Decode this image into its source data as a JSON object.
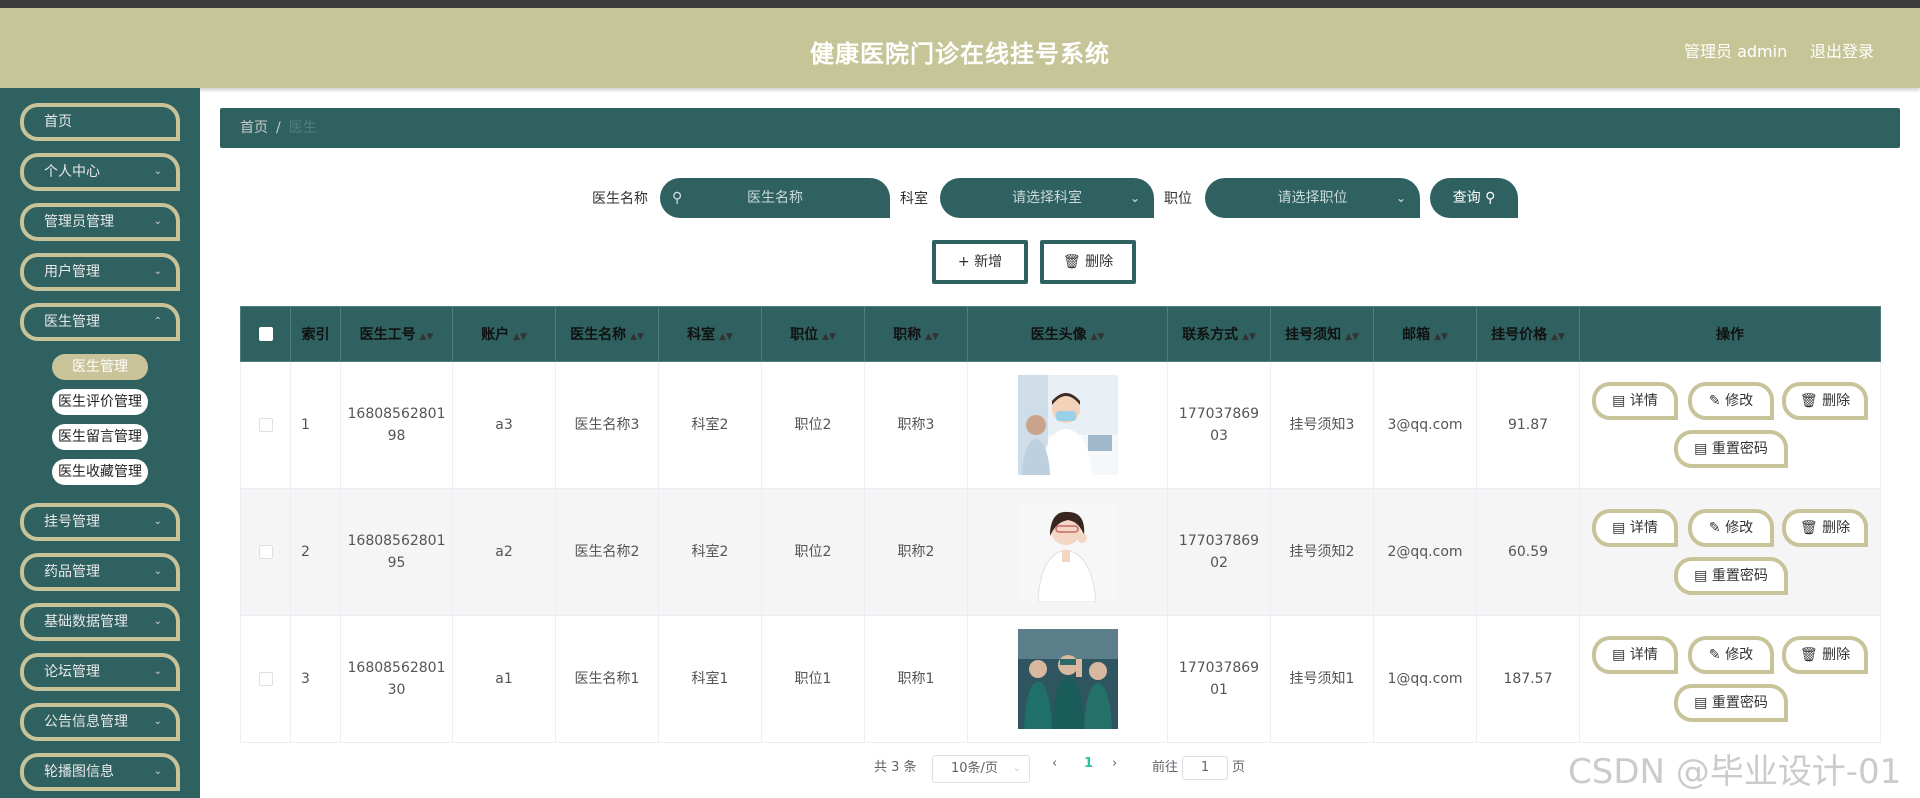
{
  "header": {
    "title": "健康医院门诊在线挂号系统",
    "admin_label": "管理员 admin",
    "logout_label": "退出登录"
  },
  "sidebar": {
    "items": [
      {
        "label": "首页"
      },
      {
        "label": "个人中心"
      },
      {
        "label": "管理员管理"
      },
      {
        "label": "用户管理"
      },
      {
        "label": "医生管理"
      },
      {
        "label": "挂号管理"
      },
      {
        "label": "药品管理"
      },
      {
        "label": "基础数据管理"
      },
      {
        "label": "论坛管理"
      },
      {
        "label": "公告信息管理"
      },
      {
        "label": "轮播图信息"
      }
    ],
    "sub_items": [
      {
        "label": "医生管理"
      },
      {
        "label": "医生评价管理"
      },
      {
        "label": "医生留言管理"
      },
      {
        "label": "医生收藏管理"
      }
    ]
  },
  "breadcrumb": {
    "home": "首页",
    "sep": "/",
    "current": "医生"
  },
  "filters": {
    "name_label": "医生名称",
    "name_placeholder": "医生名称",
    "dept_label": "科室",
    "dept_placeholder": "请选择科室",
    "position_label": "职位",
    "position_placeholder": "请选择职位",
    "query_label": "查询"
  },
  "actions": {
    "add_label": "新增",
    "delete_label": "删除"
  },
  "table": {
    "headers": [
      "索引",
      "医生工号",
      "账户",
      "医生名称",
      "科室",
      "职位",
      "职称",
      "医生头像",
      "联系方式",
      "挂号须知",
      "邮箱",
      "挂号价格",
      "操作"
    ],
    "rows": [
      {
        "index": "1",
        "code_a": "16808562801",
        "code_b": "98",
        "account": "a3",
        "name": "医生名称3",
        "dept": "科室2",
        "position": "职位2",
        "title": "职称3",
        "phone_a": "177037869",
        "phone_b": "03",
        "notice": "挂号须知3",
        "email": "3@qq.com",
        "price": "91.87"
      },
      {
        "index": "2",
        "code_a": "16808562801",
        "code_b": "95",
        "account": "a2",
        "name": "医生名称2",
        "dept": "科室2",
        "position": "职位2",
        "title": "职称2",
        "phone_a": "177037869",
        "phone_b": "02",
        "notice": "挂号须知2",
        "email": "2@qq.com",
        "price": "60.59"
      },
      {
        "index": "3",
        "code_a": "16808562801",
        "code_b": "30",
        "account": "a1",
        "name": "医生名称1",
        "dept": "科室1",
        "position": "职位1",
        "title": "职称1",
        "phone_a": "177037869",
        "phone_b": "01",
        "notice": "挂号须知1",
        "email": "1@qq.com",
        "price": "187.57"
      }
    ],
    "row_ops": {
      "detail": "详情",
      "edit": "修改",
      "delete": "删除",
      "reset": "重置密码"
    }
  },
  "pager": {
    "total": "共 3 条",
    "page_size": "10条/页",
    "current_page": "1",
    "goto_label": "前往",
    "goto_value": "1",
    "page_unit": "页"
  },
  "watermark": "CSDN @毕业设计-01",
  "colors": {
    "header": "#c5c597",
    "sidebar": "#2f6161",
    "accent_border": "#c8c398",
    "page_active": "#26c6a0"
  }
}
